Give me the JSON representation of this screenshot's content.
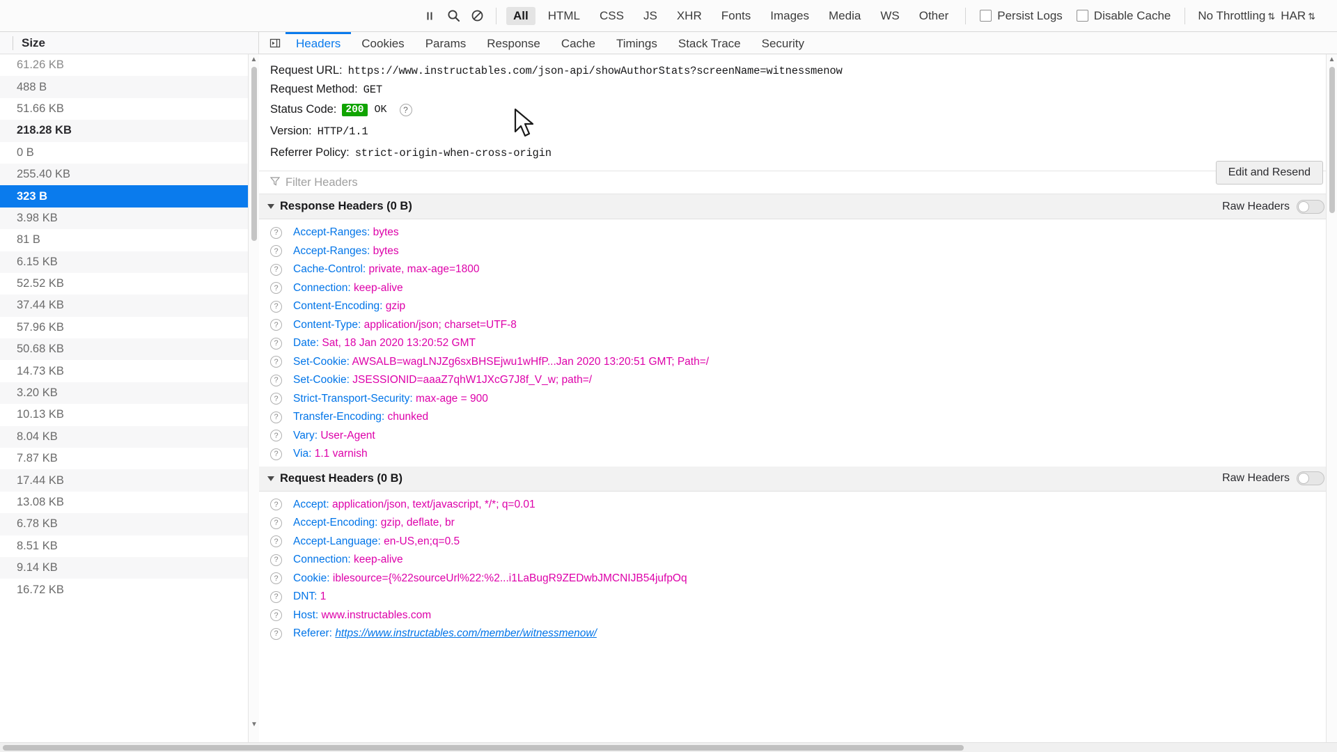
{
  "toolbar": {
    "pause_icon": "pause-icon",
    "search_icon": "search-icon",
    "clear_icon": "block-clear-icon",
    "filters": [
      "All",
      "HTML",
      "CSS",
      "JS",
      "XHR",
      "Fonts",
      "Images",
      "Media",
      "WS",
      "Other"
    ],
    "active_filter": "All",
    "persist_logs_label": "Persist Logs",
    "disable_cache_label": "Disable Cache",
    "throttling_label": "No Throttling",
    "throttling_arrows": "⇅",
    "har_label": "HAR",
    "har_arrows": "⇅"
  },
  "left_pane": {
    "column_header": "Size",
    "rows": [
      {
        "size": "61.26 KB",
        "selected": false,
        "partial": true,
        "bold": false
      },
      {
        "size": "488 B",
        "selected": false,
        "partial": false,
        "bold": false
      },
      {
        "size": "51.66 KB",
        "selected": false,
        "partial": false,
        "bold": false
      },
      {
        "size": "218.28 KB",
        "selected": false,
        "partial": false,
        "bold": true
      },
      {
        "size": "0 B",
        "selected": false,
        "partial": false,
        "bold": false
      },
      {
        "size": "255.40 KB",
        "selected": false,
        "partial": false,
        "bold": false
      },
      {
        "size": "323 B",
        "selected": true,
        "partial": false,
        "bold": true
      },
      {
        "size": "3.98 KB",
        "selected": false,
        "partial": false,
        "bold": false
      },
      {
        "size": "81 B",
        "selected": false,
        "partial": false,
        "bold": false
      },
      {
        "size": "6.15 KB",
        "selected": false,
        "partial": false,
        "bold": false
      },
      {
        "size": "52.52 KB",
        "selected": false,
        "partial": false,
        "bold": false
      },
      {
        "size": "37.44 KB",
        "selected": false,
        "partial": false,
        "bold": false
      },
      {
        "size": "57.96 KB",
        "selected": false,
        "partial": false,
        "bold": false
      },
      {
        "size": "50.68 KB",
        "selected": false,
        "partial": false,
        "bold": false
      },
      {
        "size": "14.73 KB",
        "selected": false,
        "partial": false,
        "bold": false
      },
      {
        "size": "3.20 KB",
        "selected": false,
        "partial": false,
        "bold": false
      },
      {
        "size": "10.13 KB",
        "selected": false,
        "partial": false,
        "bold": false
      },
      {
        "size": "8.04 KB",
        "selected": false,
        "partial": false,
        "bold": false
      },
      {
        "size": "7.87 KB",
        "selected": false,
        "partial": false,
        "bold": false
      },
      {
        "size": "17.44 KB",
        "selected": false,
        "partial": false,
        "bold": false
      },
      {
        "size": "13.08 KB",
        "selected": false,
        "partial": false,
        "bold": false
      },
      {
        "size": "6.78 KB",
        "selected": false,
        "partial": false,
        "bold": false
      },
      {
        "size": "8.51 KB",
        "selected": false,
        "partial": false,
        "bold": false
      },
      {
        "size": "9.14 KB",
        "selected": false,
        "partial": false,
        "bold": false
      },
      {
        "size": "16.72 KB",
        "selected": false,
        "partial": false,
        "bold": false
      }
    ]
  },
  "detail_tabs": {
    "items": [
      "Headers",
      "Cookies",
      "Params",
      "Response",
      "Cache",
      "Timings",
      "Stack Trace",
      "Security"
    ],
    "active": "Headers"
  },
  "summary": {
    "request_url_label": "Request URL:",
    "request_url_value": "https://www.instructables.com/json-api/showAuthorStats?screenName=witnessmenow",
    "request_method_label": "Request Method:",
    "request_method_value": "GET",
    "status_code_label": "Status Code:",
    "status_code_badge": "200",
    "status_code_text": "OK",
    "version_label": "Version:",
    "version_value": "HTTP/1.1",
    "referrer_policy_label": "Referrer Policy:",
    "referrer_policy_value": "strict-origin-when-cross-origin",
    "edit_resend_label": "Edit and Resend"
  },
  "filter_headers": {
    "placeholder": "Filter Headers",
    "icon": "funnel-icon"
  },
  "response_headers": {
    "title": "Response Headers (0 B)",
    "raw_label": "Raw Headers",
    "raw_enabled": false,
    "items": [
      {
        "name": "Accept-Ranges:",
        "value": "bytes"
      },
      {
        "name": "Accept-Ranges:",
        "value": "bytes"
      },
      {
        "name": "Cache-Control:",
        "value": "private, max-age=1800"
      },
      {
        "name": "Connection:",
        "value": "keep-alive"
      },
      {
        "name": "Content-Encoding:",
        "value": "gzip"
      },
      {
        "name": "Content-Type:",
        "value": "application/json; charset=UTF-8"
      },
      {
        "name": "Date:",
        "value": "Sat, 18 Jan 2020 13:20:52 GMT"
      },
      {
        "name": "Set-Cookie:",
        "value": "AWSALB=wagLNJZg6sxBHSEjwu1wHfP...Jan 2020 13:20:51 GMT; Path=/"
      },
      {
        "name": "Set-Cookie:",
        "value": "JSESSIONID=aaaZ7qhW1JXcG7J8f_V_w; path=/"
      },
      {
        "name": "Strict-Transport-Security:",
        "value": "max-age = 900"
      },
      {
        "name": "Transfer-Encoding:",
        "value": "chunked"
      },
      {
        "name": "Vary:",
        "value": "User-Agent"
      },
      {
        "name": "Via:",
        "value": "1.1 varnish"
      }
    ]
  },
  "request_headers": {
    "title": "Request Headers (0 B)",
    "raw_label": "Raw Headers",
    "raw_enabled": false,
    "items": [
      {
        "name": "Accept:",
        "value": "application/json, text/javascript, */*; q=0.01",
        "link": false
      },
      {
        "name": "Accept-Encoding:",
        "value": "gzip, deflate, br",
        "link": false
      },
      {
        "name": "Accept-Language:",
        "value": "en-US,en;q=0.5",
        "link": false
      },
      {
        "name": "Connection:",
        "value": "keep-alive",
        "link": false
      },
      {
        "name": "Cookie:",
        "value": "iblesource={%22sourceUrl%22:%2...i1LaBugR9ZEDwbJMCNIJB54jufpOq",
        "link": false
      },
      {
        "name": "DNT:",
        "value": "1",
        "link": false
      },
      {
        "name": "Host:",
        "value": "www.instructables.com",
        "link": false
      },
      {
        "name": "Referer:",
        "value": "https://www.instructables.com/member/witnessmenow/",
        "link": true
      }
    ]
  }
}
